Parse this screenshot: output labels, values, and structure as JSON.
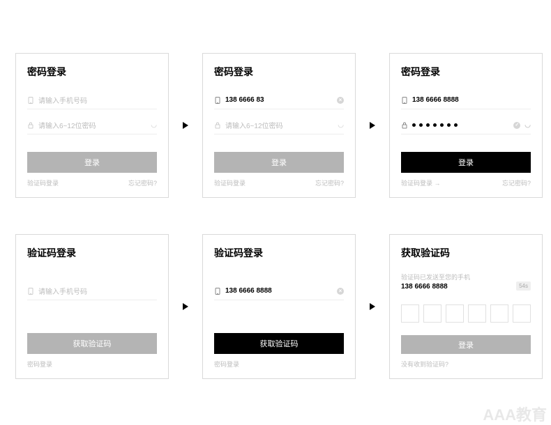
{
  "cards": {
    "c1": {
      "title": "密码登录",
      "phone_ph": "请输入手机号码",
      "pwd_ph": "请输入6~12位密码",
      "btn": "登录",
      "footL": "验证码登录",
      "footR": "忘记密码?"
    },
    "c2": {
      "title": "密码登录",
      "phone_val": "138 6666 83",
      "pwd_ph": "请输入6~12位密码",
      "btn": "登录",
      "footL": "验证码登录",
      "footR": "忘记密码?"
    },
    "c3": {
      "title": "密码登录",
      "phone_val": "138 6666 8888",
      "pwd_dots": 7,
      "btn": "登录",
      "footL": "验证码登录 →",
      "footR": "忘记密码?"
    },
    "c4": {
      "title": "验证码登录",
      "phone_ph": "请输入手机号码",
      "btn": "获取验证码",
      "footL": "密码登录"
    },
    "c5": {
      "title": "验证码登录",
      "phone_val": "138 6666 8888",
      "btn": "获取验证码",
      "footL": "密码登录"
    },
    "c6": {
      "title": "获取验证码",
      "sent_msg": "验证码已发送至您的手机",
      "phone_val": "138 6666 8888",
      "countdown": "54s",
      "btn": "登录",
      "footL": "没有收到验证码?"
    }
  },
  "watermark": "AAA教育"
}
